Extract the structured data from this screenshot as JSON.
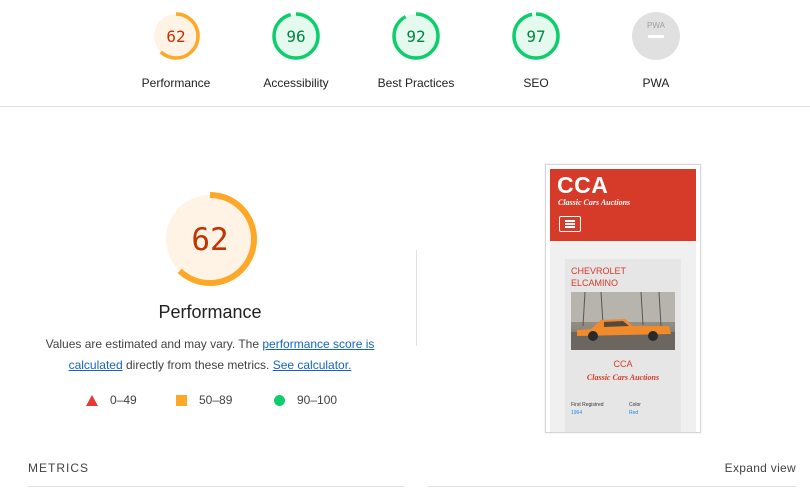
{
  "colors": {
    "average": "#ffa726",
    "average_text": "#c33300",
    "average_bg": "#fff3e6",
    "pass": "#0cce6b",
    "pass_text": "#018642",
    "pass_bg": "#e5faef",
    "fail": "#e53935",
    "na": "#9e9e9e",
    "link": "#1565c0",
    "brand": "#d63a28"
  },
  "gauges": [
    {
      "label": "Performance",
      "score": "62",
      "value": 62,
      "status": "average"
    },
    {
      "label": "Accessibility",
      "score": "96",
      "value": 96,
      "status": "pass"
    },
    {
      "label": "Best Practices",
      "score": "92",
      "value": 92,
      "status": "pass"
    },
    {
      "label": "SEO",
      "score": "97",
      "value": 97,
      "status": "pass"
    },
    {
      "label": "PWA",
      "score": "",
      "value": null,
      "status": "na",
      "badge_text": "PWA"
    }
  ],
  "performance": {
    "score": "62",
    "value": 62,
    "title": "Performance",
    "desc_prefix": "Values are estimated and may vary. The ",
    "desc_link1": "performance score is calculated",
    "desc_middle": " directly from these metrics. ",
    "desc_link2": "See calculator."
  },
  "legend": [
    {
      "shape": "triangle-icon",
      "range": "0–49"
    },
    {
      "shape": "square-icon",
      "range": "50–89"
    },
    {
      "shape": "circle-icon",
      "range": "90–100"
    }
  ],
  "screenshot": {
    "logo": "CCA",
    "subtitle": "Classic Cars Auctions",
    "card_title_line1": "CHEVROLET",
    "card_title_line2": "ELCAMINO",
    "card_brand": "CCA",
    "card_subtitle": "Classic Cars Auctions",
    "field1_label": "First Registred",
    "field1_value": "1964",
    "field2_label": "Color",
    "field2_value": "Red"
  },
  "metrics": {
    "heading": "METRICS",
    "expand": "Expand view"
  }
}
